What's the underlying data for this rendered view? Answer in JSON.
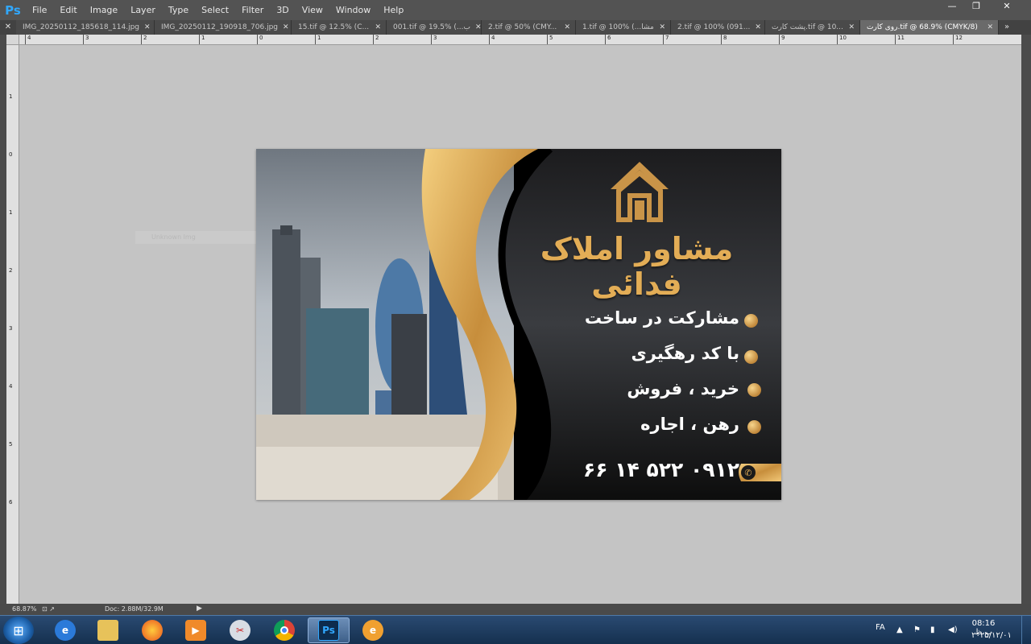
{
  "app": {
    "logo": "Ps"
  },
  "menu": [
    "File",
    "Edit",
    "Image",
    "Layer",
    "Type",
    "Select",
    "Filter",
    "3D",
    "View",
    "Window",
    "Help"
  ],
  "window_controls": {
    "minimize": "—",
    "restore": "❐",
    "close": "✕"
  },
  "tabs": [
    {
      "label": "IMG_20250112_185618_114.jpg",
      "active": false
    },
    {
      "label": "IMG_20250112_190918_706.jpg",
      "active": false
    },
    {
      "label": "15.tif @ 12.5% (C...",
      "active": false
    },
    {
      "label": "001.tif @ 19.5% (...ب",
      "active": false
    },
    {
      "label": "2.tif @ 50% (CMY...",
      "active": false
    },
    {
      "label": "1.tif @ 100% (...مشا",
      "active": false
    },
    {
      "label": "2.tif @ 100% (091...",
      "active": false
    },
    {
      "label": "پشت کارت.tif @ 10...",
      "active": false
    },
    {
      "label": "روی کارت.tif @ 68.9% (CMYK/8)",
      "active": true
    }
  ],
  "ruler_top": [
    "4",
    "3",
    "2",
    "1",
    "0",
    "1",
    "2",
    "3",
    "4",
    "5",
    "6",
    "7",
    "8",
    "9",
    "10",
    "11",
    "12"
  ],
  "ruler_left": [
    "1",
    "0",
    "1",
    "2",
    "3",
    "4",
    "5",
    "6"
  ],
  "canvas": {
    "faint_label": "Unknown lmg",
    "brand_name": "مشاور املاک فدائی",
    "services": [
      "مشارکت در ساخت",
      "با کد رهگیری",
      "خرید ، فروش",
      "رهن ، اجاره"
    ],
    "phone": "۰۹۱۲ ۵۲۲ ۱۴ ۶۶",
    "colors": {
      "gold": "#e3ad56",
      "black": "#000000",
      "sky": "#9aa4ae"
    }
  },
  "status": {
    "zoom": "68.87%",
    "doc_size": "Doc: 2.88M/32.9M"
  },
  "taskbar": {
    "apps": [
      "ie-icon",
      "explorer-icon",
      "firefox-icon",
      "media-player-icon",
      "snipping-tool-icon",
      "chrome-icon",
      "photoshop-icon",
      "app-icon"
    ],
    "photoshop_label": "Ps",
    "lang": "FA",
    "time": "08:16 ب.ظ",
    "date": "۲۰۲۵/۱۲/۰۱"
  }
}
